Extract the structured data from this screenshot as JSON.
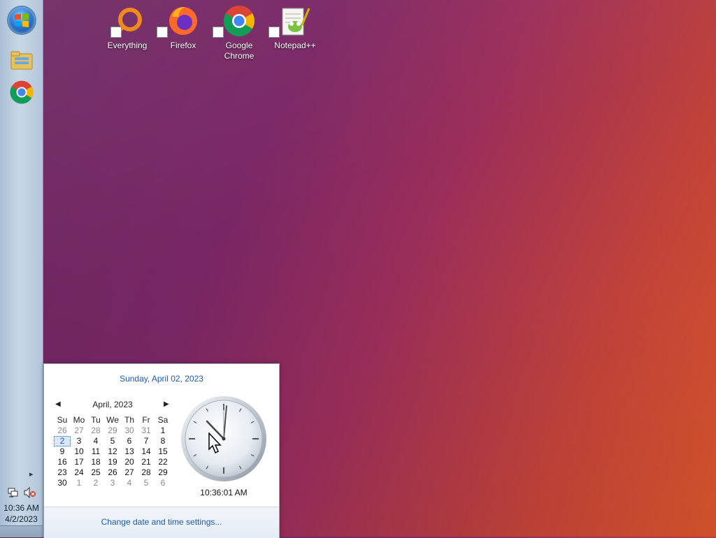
{
  "desktop": {
    "icons": [
      {
        "label": "Everything",
        "icon": "everything-icon"
      },
      {
        "label": "Firefox",
        "icon": "firefox-icon"
      },
      {
        "label": "Google\nChrome",
        "icon": "chrome-icon"
      },
      {
        "label": "Notepad++",
        "icon": "notepadpp-icon"
      }
    ]
  },
  "taskbar": {
    "pinned": [
      {
        "icon": "file-explorer-icon"
      },
      {
        "icon": "chrome-icon"
      }
    ],
    "tray": {
      "time": "10:36 AM",
      "date": "4/2/2023",
      "network_icon": "network-icon",
      "volume_icon": "volume-muted-icon"
    }
  },
  "calendar_flyout": {
    "long_date": "Sunday, April 02, 2023",
    "month_label": "April, 2023",
    "weekdays": [
      "Su",
      "Mo",
      "Tu",
      "We",
      "Th",
      "Fr",
      "Sa"
    ],
    "weeks": [
      [
        {
          "d": "26",
          "dim": true
        },
        {
          "d": "27",
          "dim": true
        },
        {
          "d": "28",
          "dim": true
        },
        {
          "d": "29",
          "dim": true
        },
        {
          "d": "30",
          "dim": true
        },
        {
          "d": "31",
          "dim": true
        },
        {
          "d": "1"
        }
      ],
      [
        {
          "d": "2",
          "today": true
        },
        {
          "d": "3"
        },
        {
          "d": "4"
        },
        {
          "d": "5"
        },
        {
          "d": "6"
        },
        {
          "d": "7"
        },
        {
          "d": "8"
        }
      ],
      [
        {
          "d": "9"
        },
        {
          "d": "10"
        },
        {
          "d": "11"
        },
        {
          "d": "12"
        },
        {
          "d": "13"
        },
        {
          "d": "14"
        },
        {
          "d": "15"
        }
      ],
      [
        {
          "d": "16"
        },
        {
          "d": "17"
        },
        {
          "d": "18"
        },
        {
          "d": "19"
        },
        {
          "d": "20"
        },
        {
          "d": "21"
        },
        {
          "d": "22"
        }
      ],
      [
        {
          "d": "23"
        },
        {
          "d": "24"
        },
        {
          "d": "25"
        },
        {
          "d": "26"
        },
        {
          "d": "27"
        },
        {
          "d": "28"
        },
        {
          "d": "29"
        }
      ],
      [
        {
          "d": "30"
        },
        {
          "d": "1",
          "dim": true
        },
        {
          "d": "2",
          "dim": true
        },
        {
          "d": "3",
          "dim": true
        },
        {
          "d": "4",
          "dim": true
        },
        {
          "d": "5",
          "dim": true
        },
        {
          "d": "6",
          "dim": true
        }
      ]
    ],
    "clock_time": "10:36:01 AM",
    "settings_link": "Change date and time settings..."
  },
  "colors": {
    "accent_link": "#1e5aa8",
    "taskbar": "#b8cbe0"
  }
}
